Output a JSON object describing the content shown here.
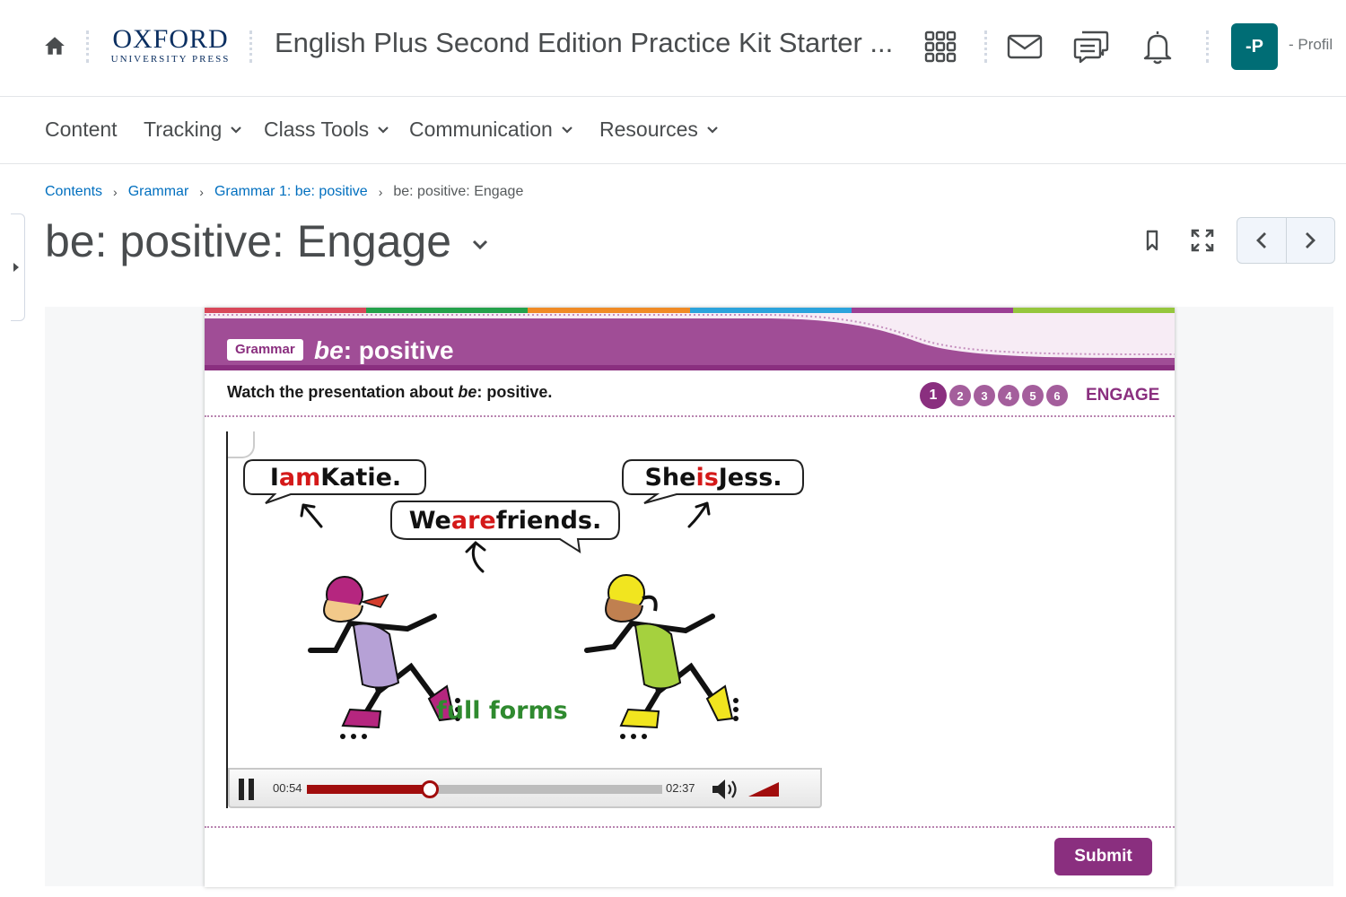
{
  "header": {
    "logo_main": "OXFORD",
    "logo_sub": "UNIVERSITY PRESS",
    "course_title": "English Plus Second Edition Practice Kit Starter ...",
    "avatar_initials": "-P",
    "profile_label": "- Profil"
  },
  "nav": {
    "items": [
      {
        "label": "Content",
        "dropdown": false
      },
      {
        "label": "Tracking",
        "dropdown": true
      },
      {
        "label": "Class Tools",
        "dropdown": true
      },
      {
        "label": "Communication",
        "dropdown": true
      },
      {
        "label": "Resources",
        "dropdown": true
      }
    ]
  },
  "breadcrumb": {
    "items": [
      "Contents",
      "Grammar",
      "Grammar 1: be: positive"
    ],
    "current": "be: positive: Engage"
  },
  "page": {
    "title": "be: positive: Engage"
  },
  "activity": {
    "strip_colors": [
      "#d8475a",
      "#23a14b",
      "#f08a25",
      "#2ba3dc",
      "#9b3f94",
      "#95c63d"
    ],
    "accent_color": "#8a2f7f",
    "badge": "Grammar",
    "title_italic": "be",
    "title_rest": ": positive",
    "instruction_prefix": "Watch the presentation about ",
    "instruction_italic": "be",
    "instruction_suffix": ": positive.",
    "steps": [
      "1",
      "2",
      "3",
      "4",
      "5",
      "6"
    ],
    "active_step": "1",
    "stage": "ENGAGE",
    "submit_label": "Submit"
  },
  "video": {
    "bubble1": {
      "pre": "I ",
      "hl": "am",
      "post": " Katie."
    },
    "bubble2": {
      "pre": "We ",
      "hl": "are",
      "post": " friends."
    },
    "bubble3": {
      "pre": "She ",
      "hl": "is",
      "post": " Jess."
    },
    "caption": "full forms",
    "elapsed": "00:54",
    "duration": "02:37",
    "progress": 0.345,
    "volume": 1.0
  }
}
